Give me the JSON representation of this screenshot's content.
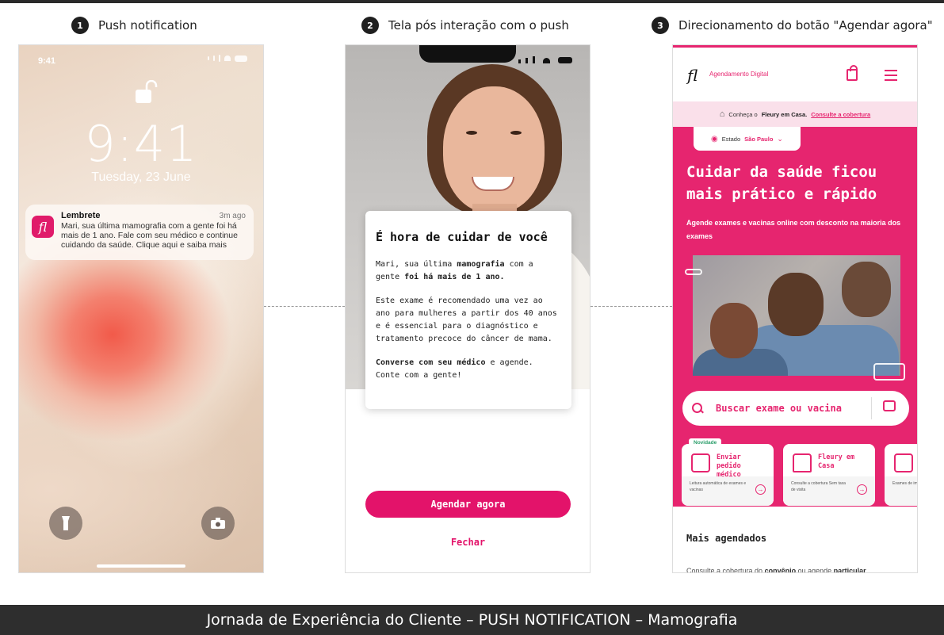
{
  "steps": [
    {
      "num": "1",
      "label": "Push notification"
    },
    {
      "num": "2",
      "label": "Tela pós interação com o push"
    },
    {
      "num": "3",
      "label": "Direcionamento do botão \"Agendar agora\""
    }
  ],
  "phone1": {
    "status_time": "9:41",
    "clock": "9:41",
    "date": "Tuesday, 23 June",
    "notification": {
      "app_letter": "fl",
      "title": "Lembrete",
      "time": "3m ago",
      "body": "Mari, sua última mamografia com a gente foi há mais de 1 ano. Fale com seu médico e continue cuidando da saúde. Clique aqui e saiba mais"
    }
  },
  "phone2": {
    "card_title": "É hora de cuidar de você",
    "p1_a": "Mari, sua última ",
    "p1_b": "mamografia",
    "p1_c": " com a gente ",
    "p1_d": "foi há mais de 1 ano.",
    "p2": "Este exame é recomendado uma vez ao ano para mulheres a partir dos 40 anos e é essencial para o diagnóstico e tratamento precoce do câncer de mama.",
    "p3_a": "Converse com seu médico",
    "p3_b": " e agende. Conte com a gente!",
    "primary_button": "Agendar agora",
    "secondary_button": "Fechar"
  },
  "phone3": {
    "logo": "fl",
    "header_title": "Agendamento Digital",
    "banner_a": "Conheça o ",
    "banner_b": "Fleury em Casa.",
    "banner_link": "Consulte a cobertura",
    "estado_label": "Estado",
    "estado_value": "São Paulo",
    "headline": "Cuidar da saúde ficou mais prático e rápido",
    "sub_a": "Agende exames e vacinas online com ",
    "sub_b": "desconto na maioria dos exames",
    "search_placeholder": "Buscar exame ou vacina",
    "badge": "Novidade",
    "cards": [
      {
        "title": "Enviar pedido médico",
        "desc": "Leitura automática de exames e vacinas"
      },
      {
        "title": "Fleury em Casa",
        "desc": "Consulte a cobertura Sem taxa de visita"
      },
      {
        "title": "",
        "desc": "Exames de imagem, s"
      }
    ],
    "section_title": "Mais agendados",
    "bottom_a": "Consulte a cobertura do ",
    "bottom_b": "convênio",
    "bottom_c": " ou agende ",
    "bottom_d": "particular"
  },
  "footer": "Jornada de Experiência do Cliente – PUSH NOTIFICATION – Mamografia",
  "colors": {
    "brand": "#e6256f",
    "button": "#e3136a",
    "footer_bg": "#2e2e2e"
  }
}
